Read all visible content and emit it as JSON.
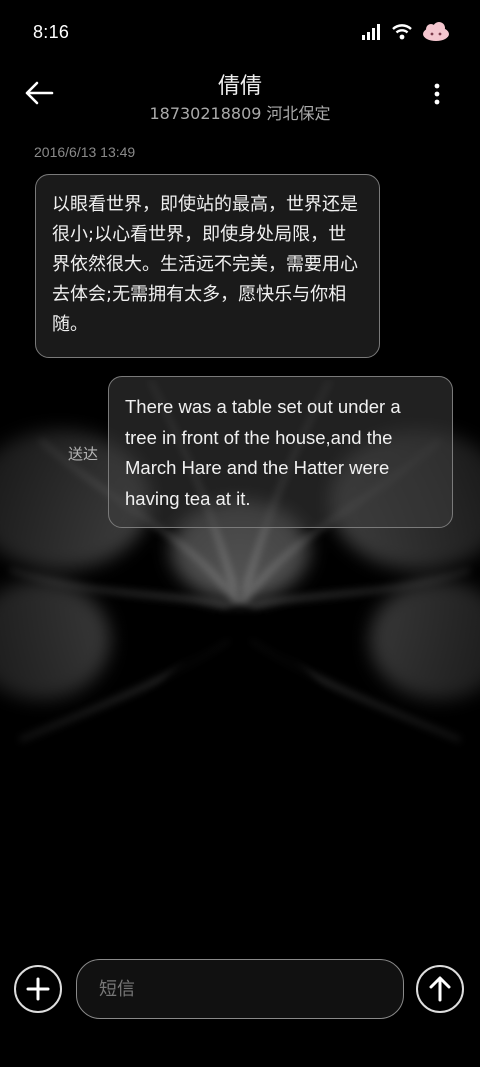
{
  "status_bar": {
    "time": "8:16",
    "icons": [
      "signal-icon",
      "wifi-icon",
      "cloud-avatar-icon"
    ]
  },
  "header": {
    "contact_name": "倩倩",
    "contact_info": "18730218809 河北保定",
    "back_icon": "arrow-left-icon",
    "more_icon": "more-vertical-icon"
  },
  "conversation": {
    "timestamp": "2016/6/13 13:49",
    "messages": [
      {
        "direction": "incoming",
        "text": "以眼看世界，即使站的最高，世界还是很小;以心看世界，即使身处局限，世界依然很大。生活远不完美，需要用心去体会;无需拥有太多，愿快乐与你相随。"
      },
      {
        "direction": "outgoing",
        "status": "送达",
        "text": "There was a table set out under a tree in front of the house,and the March Hare and the Hatter were having tea at it."
      }
    ]
  },
  "compose": {
    "placeholder": "短信",
    "value": "",
    "add_icon": "plus-circle-icon",
    "send_icon": "arrow-up-circle-icon"
  },
  "colors": {
    "background": "#000000",
    "bubble_border": "#7a7a7a",
    "text": "#f0f0f0",
    "muted": "#8a8a8a"
  }
}
